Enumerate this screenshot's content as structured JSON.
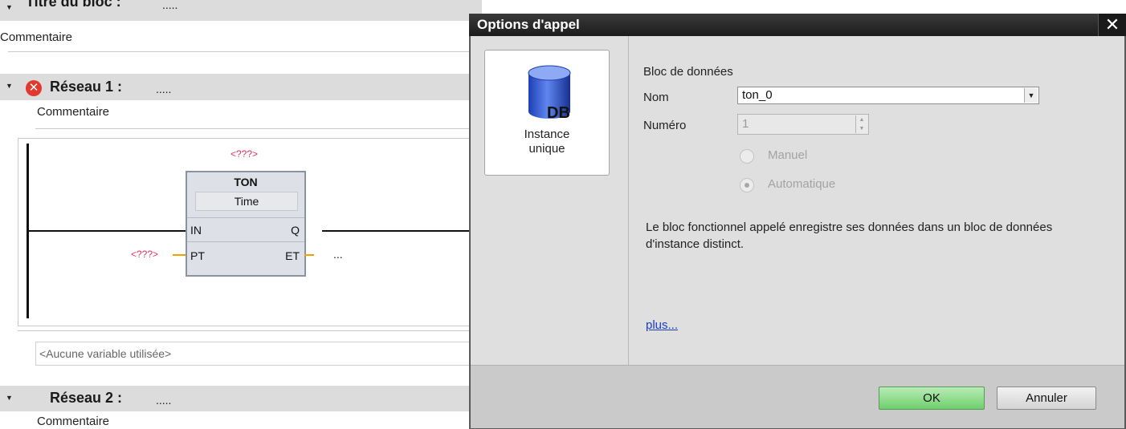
{
  "editor": {
    "block_title_label": "Titre du bloc :",
    "block_title_value": ".....",
    "block_comment": "Commentaire",
    "network1": {
      "label": "Réseau 1 :",
      "title_value": ".....",
      "comment": "Commentaire",
      "instance_placeholder": "<???>",
      "fb_name": "TON",
      "fb_type": "Time",
      "pins": {
        "in": "IN",
        "q": "Q",
        "pt": "PT",
        "et": "ET"
      },
      "pt_operand": "<???>",
      "et_operand": "...",
      "variables_note": "<Aucune variable utilisée>"
    },
    "network2": {
      "label": "Réseau 2 :",
      "title_value": ".....",
      "comment": "Commentaire"
    }
  },
  "dialog": {
    "title": "Options d'appel",
    "close_glyph": "✕",
    "instance_card": {
      "icon_text": "DB",
      "line1": "Instance",
      "line2": "unique"
    },
    "section_label": "Bloc de données",
    "name_label": "Nom",
    "name_value": "ton_0",
    "number_label": "Numéro",
    "number_value": "1",
    "radio_manual": "Manuel",
    "radio_auto": "Automatique",
    "radio_selected": "Automatique",
    "description": "Le bloc fonctionnel appelé enregistre ses données dans un bloc de données d'instance distinct.",
    "more_link": "plus...",
    "ok_label": "OK",
    "cancel_label": "Annuler"
  },
  "colors": {
    "ok_button": "#6fcf6c",
    "error_icon": "#e03a2e",
    "link": "#1a3cc8",
    "operand_red": "#e0305c",
    "pin_wire": "#f0a000"
  }
}
